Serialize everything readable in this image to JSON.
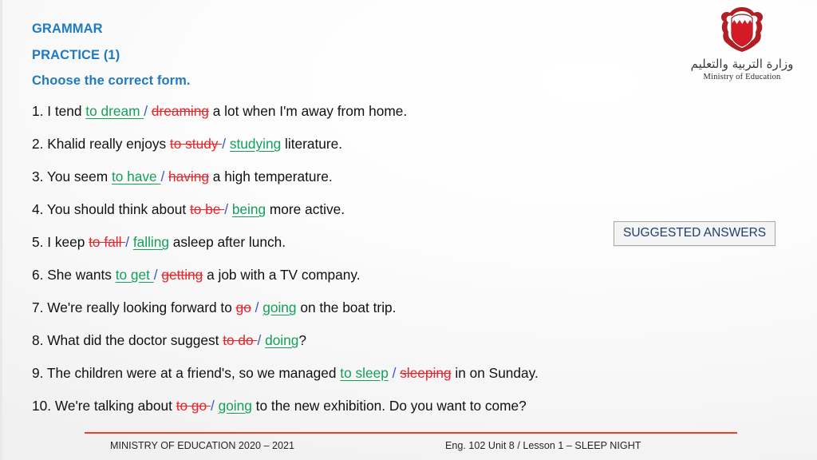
{
  "slide": {
    "headings": [
      "GRAMMAR",
      "PRACTICE (1)",
      "Choose the correct form."
    ],
    "accent_blue": "#1f7ac4",
    "correct_green": "#13a05b",
    "wrong_red": "#e8252a",
    "slash_blue": "#3457c9",
    "rule_red": "#e8412f"
  },
  "questions": [
    {
      "number": "1.",
      "pre": " I tend ",
      "first": "to dream ",
      "first_state": "correct",
      "slash": "/",
      "second": "dreaming",
      "second_state": "wrong",
      "post": " a lot when I'm away from home."
    },
    {
      "number": "2.",
      "pre": " Khalid really enjoys ",
      "first": "to study ",
      "first_state": "wrong",
      "slash": "/",
      "second": "studying",
      "second_state": "correct",
      "post": " literature."
    },
    {
      "number": "3.",
      "pre": " You seem ",
      "first": "to have ",
      "first_state": "correct",
      "slash": "/",
      "second": "having",
      "second_state": "wrong",
      "post": " a high temperature."
    },
    {
      "number": "4.",
      "pre": " You should think about ",
      "first": "to be ",
      "first_state": "wrong",
      "slash": "/",
      "second": "being",
      "second_state": "correct",
      "post": " more active."
    },
    {
      "number": "5.",
      "pre": " I keep ",
      "first": "to fall ",
      "first_state": "wrong",
      "slash": "/",
      "second": "falling",
      "second_state": "correct",
      "post": " asleep after lunch."
    },
    {
      "number": "6.",
      "pre": " She wants ",
      "first": "to get ",
      "first_state": "correct",
      "slash": "/",
      "second": "getting",
      "second_state": "wrong",
      "post": " a job with a TV company."
    },
    {
      "number": "7.",
      "pre": " We're really looking forward to ",
      "first": "go",
      "first_state": "wrong",
      "slash": "/",
      "second": "going",
      "second_state": "correct",
      "post": " on the boat trip."
    },
    {
      "number": "8.",
      "pre": " What did the doctor suggest ",
      "first": "to do ",
      "first_state": "wrong",
      "slash": "/",
      "second": "doing",
      "second_state": "correct",
      "post": "?"
    },
    {
      "number": "9.",
      "pre": " The children were at a friend's, so we managed ",
      "first": "to sleep",
      "first_state": "correct",
      "slash": "/",
      "second": "sleeping",
      "second_state": "wrong",
      "post": " in on Sunday."
    },
    {
      "number": "10.",
      "pre": " We're talking about ",
      "first": "to go ",
      "first_state": "wrong",
      "slash": "/",
      "second": "going",
      "second_state": "correct",
      "post": " to the new exhibition. Do you want to come?"
    }
  ],
  "suggested_answers": {
    "label": "SUGGESTED ANSWERS"
  },
  "logo": {
    "icon": "bahrain-coat-of-arms-icon",
    "arabic": "وزارة التربية والتعليم",
    "english": "Ministry of Education"
  },
  "footer": {
    "left": "MINISTRY OF EDUCATION 2020 – 2021",
    "right": "Eng. 102 Unit 8 / Lesson 1 – SLEEP NIGHT"
  }
}
